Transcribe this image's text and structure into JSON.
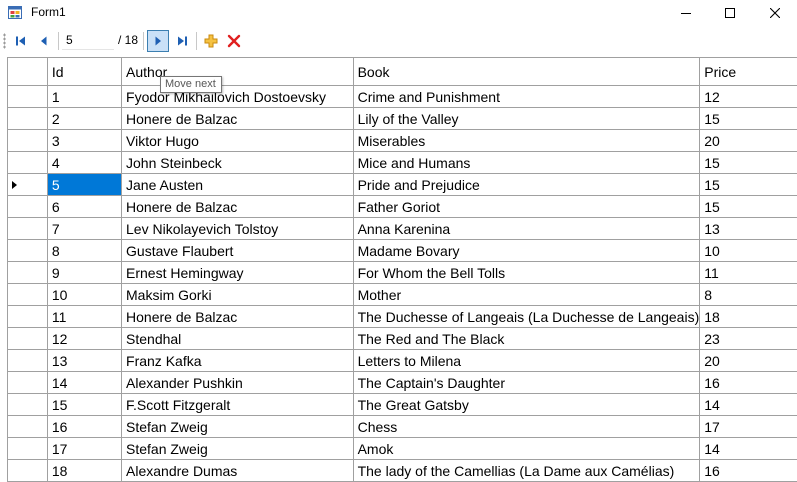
{
  "window": {
    "title": "Form1"
  },
  "navigator": {
    "position": "5",
    "count_label": "/ 18",
    "tooltip": "Move next"
  },
  "grid": {
    "columns": [
      "Id",
      "Author",
      "Book",
      "Price"
    ],
    "current_row_index": 4,
    "rows": [
      {
        "id": "1",
        "author": "Fyodor Mikhailovich Dostoevsky",
        "book": "Crime and Punishment",
        "price": "12"
      },
      {
        "id": "2",
        "author": "Honere de Balzac",
        "book": "Lily of the Valley",
        "price": "15"
      },
      {
        "id": "3",
        "author": "Viktor Hugo",
        "book": "Miserables",
        "price": "20"
      },
      {
        "id": "4",
        "author": "John Steinbeck",
        "book": "Mice and Humans",
        "price": "15"
      },
      {
        "id": "5",
        "author": "Jane Austen",
        "book": "Pride and Prejudice",
        "price": "15"
      },
      {
        "id": "6",
        "author": "Honere de Balzac",
        "book": "Father Goriot",
        "price": "15"
      },
      {
        "id": "7",
        "author": "Lev Nikolayevich Tolstoy",
        "book": "Anna Karenina",
        "price": "13"
      },
      {
        "id": "8",
        "author": "Gustave Flaubert",
        "book": "Madame Bovary",
        "price": "10"
      },
      {
        "id": "9",
        "author": "Ernest Hemingway",
        "book": "For Whom the Bell Tolls",
        "price": "11"
      },
      {
        "id": "10",
        "author": "Maksim Gorki",
        "book": "Mother",
        "price": "8"
      },
      {
        "id": "11",
        "author": "Honere de Balzac",
        "book": "The Duchesse of Langeais (La Duchesse de Langeais)",
        "price": "18"
      },
      {
        "id": "12",
        "author": "Stendhal",
        "book": "The Red and The Black",
        "price": "23"
      },
      {
        "id": "13",
        "author": "Franz Kafka",
        "book": "Letters to Milena",
        "price": "20"
      },
      {
        "id": "14",
        "author": "Alexander Pushkin",
        "book": "The Captain's Daughter",
        "price": "16"
      },
      {
        "id": "15",
        "author": "F.Scott Fitzgeralt",
        "book": "The Great Gatsby",
        "price": "14"
      },
      {
        "id": "16",
        "author": "Stefan Zweig",
        "book": "Chess",
        "price": "17"
      },
      {
        "id": "17",
        "author": "Stefan Zweig",
        "book": "Amok",
        "price": "14"
      },
      {
        "id": "18",
        "author": "Alexandre Dumas",
        "book": "The lady of the Camellias (La Dame aux Camélias)",
        "price": "16"
      }
    ]
  },
  "icons": {
    "move_first": "move-first-icon",
    "move_previous": "move-previous-icon",
    "move_next": "move-next-icon",
    "move_last": "move-last-icon",
    "add_new": "add-new-icon",
    "delete": "delete-icon"
  },
  "colors": {
    "nav_icon": "#1e5fb3",
    "selection": "#0078d7",
    "add_icon": "#e8a317",
    "delete_icon": "#e02020",
    "hot_button": "#c9e0f7"
  }
}
